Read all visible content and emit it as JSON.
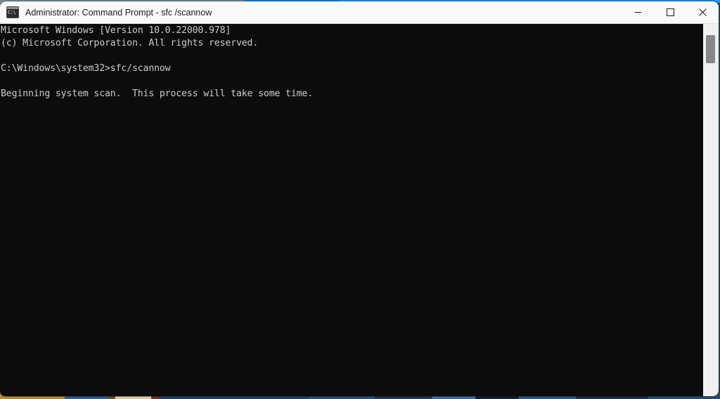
{
  "window": {
    "title": "Administrator: Command Prompt - sfc /scannow",
    "icon_name": "command-prompt-icon",
    "icon_glyph": "C:\\",
    "background_color": "#0c0c0c",
    "titlebar_color": "#f9f9f9"
  },
  "caption": {
    "minimize_label": "Minimize",
    "maximize_label": "Maximize",
    "close_label": "Close"
  },
  "console": {
    "text_color": "#cccccc",
    "lines": [
      "Microsoft Windows [Version 10.0.22000.978]",
      "(c) Microsoft Corporation. All rights reserved.",
      "",
      "C:\\Windows\\system32>sfc/scannow",
      "",
      "Beginning system scan.  This process will take some time.",
      ""
    ],
    "content": "Microsoft Windows [Version 10.0.22000.978]\n(c) Microsoft Corporation. All rights reserved.\n\nC:\\Windows\\system32>sfc/scannow\n\nBeginning system scan.  This process will take some time.\n"
  },
  "scrollbar": {
    "thumb_color": "#878787",
    "track_color": "#f0f0f0",
    "position": "top"
  }
}
